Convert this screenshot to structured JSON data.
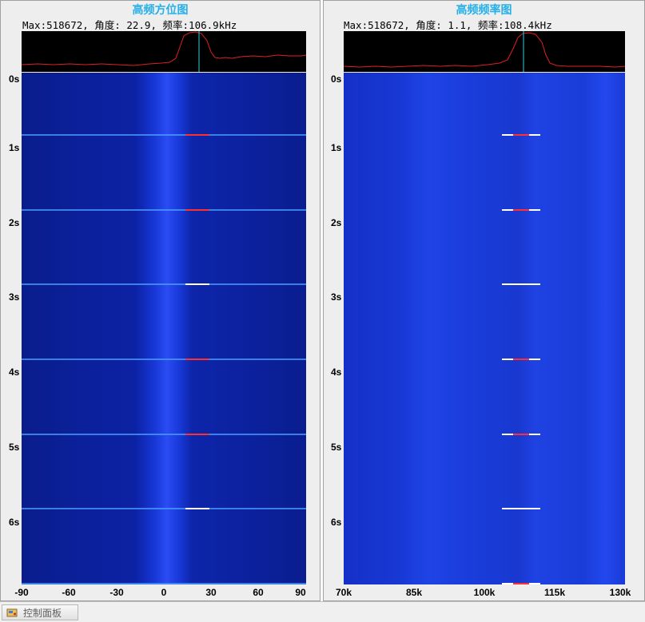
{
  "left_panel": {
    "title": "高频方位图",
    "info": "Max:518672, 角度: 22.9, 频率:106.9kHz",
    "y_ticks": [
      "0s",
      "1s",
      "2s",
      "3s",
      "4s",
      "5s",
      "6s"
    ],
    "x_ticks": [
      "-90",
      "-60",
      "-30",
      "0",
      "30",
      "60",
      "90"
    ],
    "peak_marker_value": 22.9,
    "x_range": [
      -90,
      90
    ]
  },
  "right_panel": {
    "title": "高频频率图",
    "info": "Max:518672, 角度: 1.1, 频率:108.4kHz",
    "y_ticks": [
      "0s",
      "1s",
      "2s",
      "3s",
      "4s",
      "5s",
      "6s"
    ],
    "x_ticks": [
      "70k",
      "85k",
      "100k",
      "115k",
      "130k"
    ],
    "peak_marker_value": 108.4,
    "x_range": [
      70,
      130
    ]
  },
  "statusbar": {
    "control_panel_label": "控制面板",
    "control_panel_icon": "control-panel-icon"
  },
  "colors": {
    "title": "#26b0e8",
    "waterfall_base": "#0a1f9c",
    "spectrum_line": "#e02020",
    "peak_marker": "#30d0e0"
  }
}
